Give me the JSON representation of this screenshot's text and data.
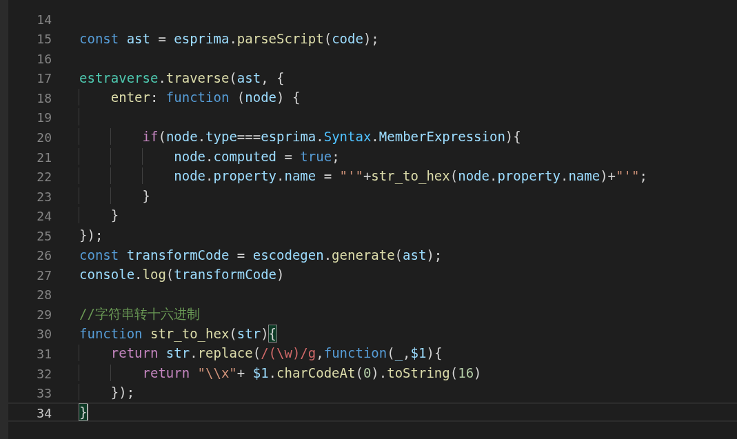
{
  "editor": {
    "lines": [
      {
        "number": "14",
        "current": false
      },
      {
        "number": "15",
        "current": false,
        "tokens": [
          {
            "kind": "keyword",
            "text": "const"
          },
          {
            "kind": "variable",
            "text": " ast"
          },
          {
            "kind": "plain",
            "text": " = "
          },
          {
            "kind": "variable",
            "text": "esprima"
          },
          {
            "kind": "plain",
            "text": "."
          },
          {
            "kind": "function",
            "text": "parseScript"
          },
          {
            "kind": "plain",
            "text": "("
          },
          {
            "kind": "variable",
            "text": "code"
          },
          {
            "kind": "plain",
            "text": ");"
          }
        ]
      },
      {
        "number": "16",
        "current": false
      },
      {
        "number": "17",
        "current": false,
        "tokens": [
          {
            "kind": "class",
            "text": "estraverse"
          },
          {
            "kind": "plain",
            "text": "."
          },
          {
            "kind": "function",
            "text": "traverse"
          },
          {
            "kind": "plain",
            "text": "("
          },
          {
            "kind": "variable",
            "text": "ast"
          },
          {
            "kind": "plain",
            "text": ", {"
          }
        ]
      },
      {
        "number": "18",
        "current": false,
        "tokens": [
          {
            "kind": "function",
            "text": "    enter"
          },
          {
            "kind": "plain",
            "text": ": "
          },
          {
            "kind": "keyword",
            "text": "function"
          },
          {
            "kind": "plain",
            "text": " ("
          },
          {
            "kind": "variable",
            "text": "node"
          },
          {
            "kind": "plain",
            "text": ") {"
          }
        ]
      },
      {
        "number": "19",
        "current": false
      },
      {
        "number": "20",
        "current": false,
        "tokens": [
          {
            "kind": "control",
            "text": "        if"
          },
          {
            "kind": "plain",
            "text": "("
          },
          {
            "kind": "variable",
            "text": "node"
          },
          {
            "kind": "plain",
            "text": "."
          },
          {
            "kind": "variable",
            "text": "type"
          },
          {
            "kind": "plain",
            "text": "==="
          },
          {
            "kind": "variable",
            "text": "esprima"
          },
          {
            "kind": "plain",
            "text": "."
          },
          {
            "kind": "constant",
            "text": "Syntax"
          },
          {
            "kind": "plain",
            "text": "."
          },
          {
            "kind": "variable",
            "text": "MemberExpression"
          },
          {
            "kind": "plain",
            "text": "){"
          }
        ]
      },
      {
        "number": "21",
        "current": false,
        "tokens": [
          {
            "kind": "variable",
            "text": "            node"
          },
          {
            "kind": "plain",
            "text": "."
          },
          {
            "kind": "variable",
            "text": "computed"
          },
          {
            "kind": "plain",
            "text": " = "
          },
          {
            "kind": "keyword",
            "text": "true"
          },
          {
            "kind": "plain",
            "text": ";"
          }
        ]
      },
      {
        "number": "22",
        "current": false,
        "tokens": [
          {
            "kind": "variable",
            "text": "            node"
          },
          {
            "kind": "plain",
            "text": "."
          },
          {
            "kind": "variable",
            "text": "property"
          },
          {
            "kind": "plain",
            "text": "."
          },
          {
            "kind": "variable",
            "text": "name"
          },
          {
            "kind": "plain",
            "text": " = "
          },
          {
            "kind": "string",
            "text": "\"'\""
          },
          {
            "kind": "plain",
            "text": "+"
          },
          {
            "kind": "function",
            "text": "str_to_hex"
          },
          {
            "kind": "plain",
            "text": "("
          },
          {
            "kind": "variable",
            "text": "node"
          },
          {
            "kind": "plain",
            "text": "."
          },
          {
            "kind": "variable",
            "text": "property"
          },
          {
            "kind": "plain",
            "text": "."
          },
          {
            "kind": "variable",
            "text": "name"
          },
          {
            "kind": "plain",
            "text": ")+"
          },
          {
            "kind": "string",
            "text": "\"'\""
          },
          {
            "kind": "plain",
            "text": ";"
          }
        ]
      },
      {
        "number": "23",
        "current": false,
        "tokens": [
          {
            "kind": "plain",
            "text": "        }"
          }
        ]
      },
      {
        "number": "24",
        "current": false,
        "tokens": [
          {
            "kind": "plain",
            "text": "    }"
          }
        ]
      },
      {
        "number": "25",
        "current": false,
        "tokens": [
          {
            "kind": "plain",
            "text": "});"
          }
        ]
      },
      {
        "number": "26",
        "current": false,
        "tokens": [
          {
            "kind": "keyword",
            "text": "const"
          },
          {
            "kind": "variable",
            "text": " transformCode"
          },
          {
            "kind": "plain",
            "text": " = "
          },
          {
            "kind": "variable",
            "text": "escodegen"
          },
          {
            "kind": "plain",
            "text": "."
          },
          {
            "kind": "function",
            "text": "generate"
          },
          {
            "kind": "plain",
            "text": "("
          },
          {
            "kind": "variable",
            "text": "ast"
          },
          {
            "kind": "plain",
            "text": ");"
          }
        ]
      },
      {
        "number": "27",
        "current": false,
        "tokens": [
          {
            "kind": "variable",
            "text": "console"
          },
          {
            "kind": "plain",
            "text": "."
          },
          {
            "kind": "function",
            "text": "log"
          },
          {
            "kind": "plain",
            "text": "("
          },
          {
            "kind": "variable",
            "text": "transformCode"
          },
          {
            "kind": "plain",
            "text": ")"
          }
        ]
      },
      {
        "number": "28",
        "current": false
      },
      {
        "number": "29",
        "current": false,
        "tokens": [
          {
            "kind": "comment",
            "text": "//字符串转十六进制"
          }
        ]
      },
      {
        "number": "30",
        "current": false,
        "tokens": [
          {
            "kind": "keyword",
            "text": "function"
          },
          {
            "kind": "function",
            "text": " str_to_hex"
          },
          {
            "kind": "plain",
            "text": "("
          },
          {
            "kind": "variable",
            "text": "str"
          },
          {
            "kind": "plain",
            "text": ")"
          },
          {
            "kind": "bracket_match",
            "text": "{"
          }
        ]
      },
      {
        "number": "31",
        "current": false,
        "tokens": [
          {
            "kind": "control",
            "text": "    return"
          },
          {
            "kind": "variable",
            "text": " str"
          },
          {
            "kind": "plain",
            "text": "."
          },
          {
            "kind": "function",
            "text": "replace"
          },
          {
            "kind": "plain",
            "text": "("
          },
          {
            "kind": "regex",
            "text": "/(\\w)/g"
          },
          {
            "kind": "plain",
            "text": ","
          },
          {
            "kind": "keyword",
            "text": "function"
          },
          {
            "kind": "plain",
            "text": "("
          },
          {
            "kind": "variable",
            "text": "_"
          },
          {
            "kind": "plain",
            "text": ","
          },
          {
            "kind": "variable",
            "text": "$1"
          },
          {
            "kind": "plain",
            "text": "){"
          }
        ]
      },
      {
        "number": "32",
        "current": false,
        "tokens": [
          {
            "kind": "control",
            "text": "        return"
          },
          {
            "kind": "string",
            "text": " \"\\\\x\""
          },
          {
            "kind": "plain",
            "text": "+ "
          },
          {
            "kind": "variable",
            "text": "$1"
          },
          {
            "kind": "plain",
            "text": "."
          },
          {
            "kind": "function",
            "text": "charCodeAt"
          },
          {
            "kind": "plain",
            "text": "("
          },
          {
            "kind": "number",
            "text": "0"
          },
          {
            "kind": "plain",
            "text": ")."
          },
          {
            "kind": "function",
            "text": "toString"
          },
          {
            "kind": "plain",
            "text": "("
          },
          {
            "kind": "number",
            "text": "16"
          },
          {
            "kind": "plain",
            "text": ")"
          }
        ]
      },
      {
        "number": "33",
        "current": false,
        "tokens": [
          {
            "kind": "plain",
            "text": "    });"
          }
        ]
      },
      {
        "number": "34",
        "current": true,
        "tokens": [
          {
            "kind": "bracket_match",
            "text": "}"
          }
        ]
      }
    ]
  }
}
